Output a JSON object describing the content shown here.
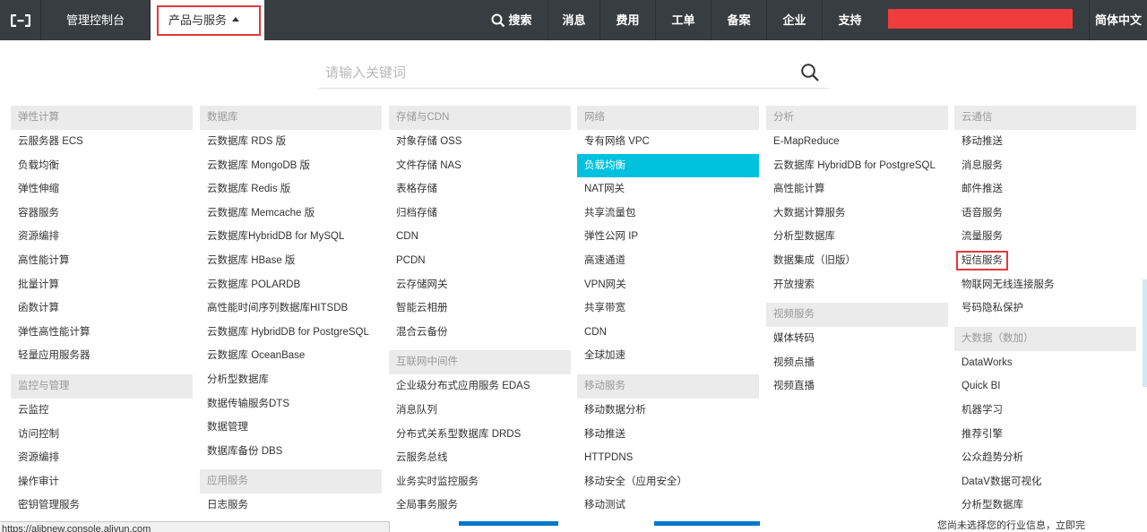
{
  "topbar": {
    "console_label": "管理控制台",
    "products_label": "产品与服务",
    "search_label": "搜索",
    "nav": [
      "消息",
      "费用",
      "工单",
      "备案",
      "企业",
      "支持"
    ],
    "lang_label": "简体中文"
  },
  "search": {
    "placeholder": "请输入关键词"
  },
  "columns": [
    {
      "groups": [
        {
          "title": "弹性计算",
          "items": [
            "云服务器 ECS",
            "负载均衡",
            "弹性伸缩",
            "容器服务",
            "资源编排",
            "高性能计算",
            "批量计算",
            "函数计算",
            "弹性高性能计算",
            "轻量应用服务器"
          ]
        },
        {
          "title": "监控与管理",
          "items": [
            "云监控",
            "访问控制",
            "资源编排",
            "操作审计",
            "密钥管理服务"
          ]
        }
      ]
    },
    {
      "groups": [
        {
          "title": "数据库",
          "items": [
            "云数据库 RDS 版",
            "云数据库 MongoDB 版",
            "云数据库 Redis 版",
            "云数据库 Memcache 版",
            "云数据库HybridDB for MySQL",
            "云数据库 HBase 版",
            "云数据库 POLARDB",
            "高性能时间序列数据库HITSDB",
            "云数据库 HybridDB for PostgreSQL",
            "云数据库 OceanBase",
            "分析型数据库",
            "数据传输服务DTS",
            "数据管理",
            "数据库备份 DBS"
          ]
        },
        {
          "title": "应用服务",
          "items": [
            "日志服务"
          ]
        }
      ]
    },
    {
      "groups": [
        {
          "title": "存储与CDN",
          "items": [
            "对象存储 OSS",
            "文件存储 NAS",
            "表格存储",
            "归档存储",
            "CDN",
            "PCDN",
            "云存储网关",
            "智能云相册",
            "混合云备份"
          ]
        },
        {
          "title": "互联网中间件",
          "items": [
            "企业级分布式应用服务 EDAS",
            "消息队列",
            "分布式关系型数据库 DRDS",
            "云服务总线",
            "业务实时监控服务",
            "全局事务服务"
          ]
        }
      ]
    },
    {
      "groups": [
        {
          "title": "网络",
          "items": [
            "专有网络 VPC",
            "负载均衡",
            "NAT网关",
            "共享流量包",
            "弹性公网 IP",
            "高速通道",
            "VPN网关",
            "共享带宽",
            "CDN",
            "全球加速"
          ]
        },
        {
          "title": "移动服务",
          "items": [
            "移动数据分析",
            "移动推送",
            "HTTPDNS",
            "移动安全（应用安全）",
            "移动测试"
          ]
        }
      ]
    },
    {
      "groups": [
        {
          "title": "分析",
          "items": [
            "E-MapReduce",
            "云数据库 HybridDB for PostgreSQL",
            "高性能计算",
            "大数据计算服务",
            "分析型数据库",
            "数据集成（旧版）",
            "开放搜索"
          ]
        },
        {
          "title": "视频服务",
          "items": [
            "媒体转码",
            "视频点播",
            "视频直播"
          ]
        }
      ]
    },
    {
      "groups": [
        {
          "title": "云通信",
          "items": [
            "移动推送",
            "消息服务",
            "邮件推送",
            "语音服务",
            "流量服务",
            "短信服务",
            "物联网无线连接服务",
            "号码隐私保护"
          ]
        },
        {
          "title": "大数据（数加）",
          "items": [
            "DataWorks",
            "Quick BI",
            "机器学习",
            "推荐引擎",
            "公众趋势分析",
            "DataV数据可视化",
            "分析型数据库"
          ]
        }
      ]
    }
  ],
  "highlighted_item": "网络 / 负载均衡",
  "boxed_item": "云通信 / 短信服务",
  "status_url": "https://alibnew.console.aliyun.com",
  "bottom_fragment_text": "您尚未选择您的行业信息，立即完",
  "colors": {
    "topbar": "#373d41",
    "active": "#00c1de",
    "highlight_border": "#e4393c",
    "red_bar": "#f03c3c"
  }
}
